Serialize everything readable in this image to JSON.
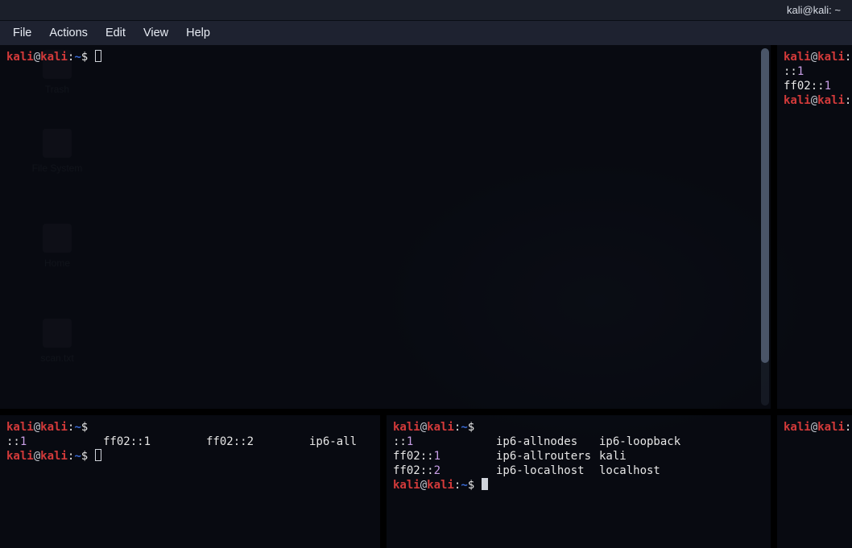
{
  "window": {
    "title": "kali@kali: ~"
  },
  "menu": {
    "file": "File",
    "actions": "Actions",
    "edit": "Edit",
    "view": "View",
    "help": "Help"
  },
  "prompt": {
    "user": "kali",
    "at": "@",
    "host": "kali",
    "colon": ":",
    "path": "~",
    "sigil": "$"
  },
  "panes": {
    "top_left": {
      "lines": []
    },
    "top_right": {
      "out": [
        {
          "addr": "::1",
          "num": "1"
        },
        {
          "addr": "ff02::",
          "num": "1"
        }
      ]
    },
    "bot_left": {
      "row": {
        "c1": "::1",
        "c2": "ff02::1",
        "c3": "ff02::2",
        "c4": "ip6-all"
      }
    },
    "bot_mid": {
      "rows": [
        {
          "c1": "::1",
          "c2": "ip6-allnodes",
          "c3": "ip6-loopback"
        },
        {
          "c1": "ff02::1",
          "c2": "ip6-allrouters",
          "c3": "kali"
        },
        {
          "c1": "ff02::2",
          "c2": "ip6-localhost",
          "c3": "localhost"
        }
      ]
    },
    "bot_right": {}
  },
  "desktop": {
    "icons": [
      {
        "label": "Trash"
      },
      {
        "label": "File System"
      },
      {
        "label": "Home"
      },
      {
        "label": "scan.txt"
      }
    ]
  }
}
